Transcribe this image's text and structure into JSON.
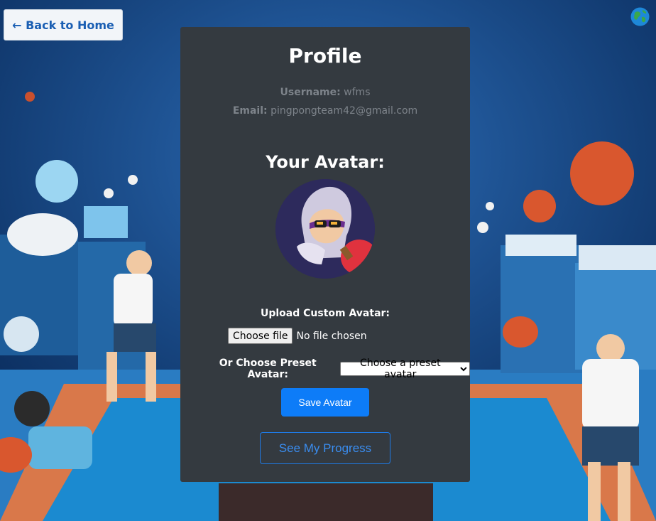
{
  "header": {
    "back_label": "← Back to Home",
    "globe_icon": "globe-icon"
  },
  "profile": {
    "title": "Profile",
    "username_label": "Username:",
    "username": "wfms",
    "email_label": "Email:",
    "email": "pingpongteam42@gmail.com"
  },
  "avatar": {
    "heading": "Your Avatar:",
    "image_icon": "hooded-player-avatar"
  },
  "upload": {
    "label": "Upload Custom Avatar:",
    "choose_file_label": "Choose file",
    "file_status": "No file chosen"
  },
  "preset": {
    "label": "Or Choose Preset Avatar:",
    "selected": "Choose a preset avatar"
  },
  "actions": {
    "save_label": "Save Avatar",
    "progress_label": "See My Progress"
  },
  "colors": {
    "panel": "#343a40",
    "primary": "#0d7cf8",
    "link": "#3a8df0"
  }
}
